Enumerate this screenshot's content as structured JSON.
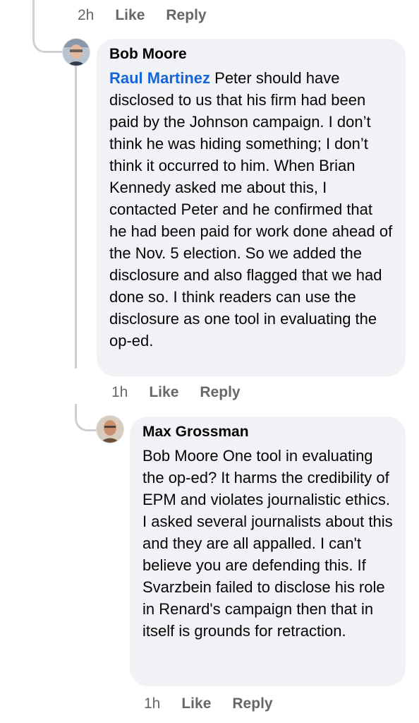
{
  "top_meta": {
    "time": "2h",
    "like": "Like",
    "reply": "Reply"
  },
  "comments": [
    {
      "author": "Bob Moore",
      "mention": "Raul Martinez",
      "text": " Peter should have disclosed to us that his firm had been paid by the Johnson campaign. I don’t think he was hiding something; I don’t think it occurred to him. When Brian Kennedy asked me about this, I contacted Peter and he confirmed that he had been paid for work done ahead of the Nov. 5 election. So we added the disclosure and also flagged that we had done so. I think readers can use the disclosure as one tool in evaluating the op-ed.",
      "time": "1h",
      "like": "Like",
      "reply": "Reply"
    },
    {
      "author": "Max Grossman",
      "mention": "",
      "text": "Bob Moore One tool in evaluating the op-ed? It harms the credibility of EPM and violates journalistic ethics. I asked several journalists about this and they are all appalled. I can't believe you are defending this. If Svarzbein failed to disclose his role in Renard's campaign then that in itself is grounds for retraction.",
      "time": "1h",
      "like": "Like",
      "reply": "Reply"
    }
  ],
  "colors": {
    "bubble": "#f0f2f5",
    "mention": "#1665d8",
    "meta": "#65676b",
    "thread": "#ccd0d5"
  }
}
